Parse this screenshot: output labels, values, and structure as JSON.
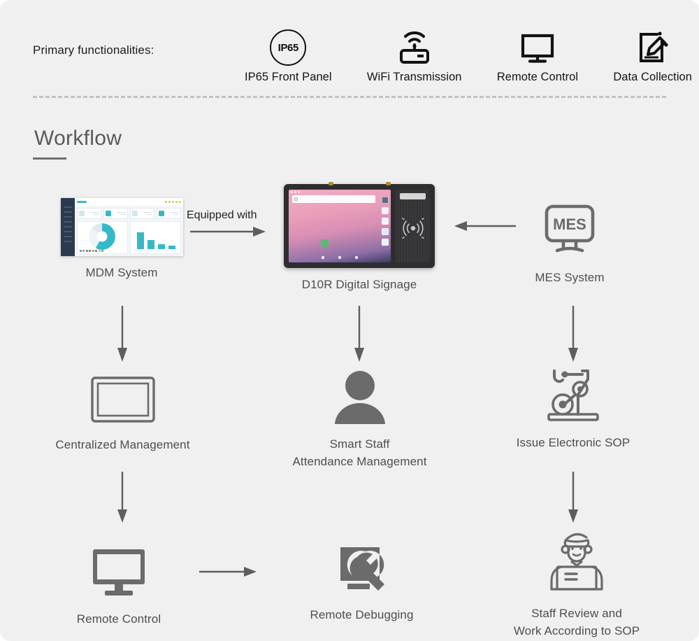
{
  "header": {
    "primary_label": "Primary functionalities:",
    "features": [
      {
        "icon": "ip65-shield-icon",
        "badge": "IP65",
        "label": "IP65 Front Panel"
      },
      {
        "icon": "wifi-router-icon",
        "label": "WiFi Transmission"
      },
      {
        "icon": "monitor-icon",
        "label": "Remote Control"
      },
      {
        "icon": "notepad-pen-icon",
        "label": "Data Collection"
      }
    ]
  },
  "workflow": {
    "title": "Workflow",
    "connector_label": "Equipped with",
    "nodes": {
      "mdm": "MDM System",
      "signage": "D10R Digital Signage",
      "mes": "MES System",
      "mes_screen_text": "MES",
      "centralized": "Centralized Management",
      "smart_staff": "Smart Staff\nAttendance Management",
      "issue_sop": "Issue Electronic SOP",
      "remote_control": "Remote Control",
      "remote_debugging": "Remote Debugging",
      "staff_review": "Staff Review and\nWork According to SOP"
    }
  },
  "colors": {
    "background": "#f0f0f0",
    "icon_gray": "#6b6b6b",
    "label_gray": "#4e4e4e",
    "accent_teal": "#35b9c8",
    "divider_gray": "#c2c2c2"
  }
}
